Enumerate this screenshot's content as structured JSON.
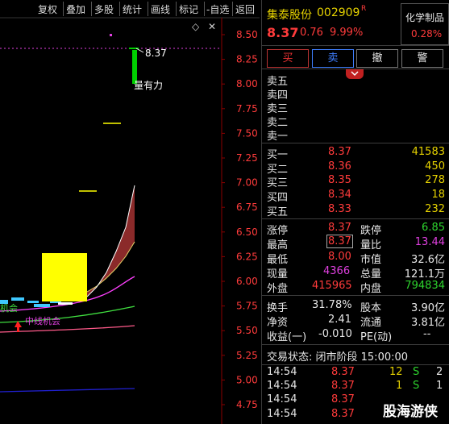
{
  "toolbar": {
    "buttons": [
      "复权",
      "叠加",
      "多股",
      "统计",
      "画线",
      "标记",
      "-自选",
      "返回"
    ],
    "diamond_icon": "◇"
  },
  "chart": {
    "y_ticks": [
      "8.50",
      "8.25",
      "8.00",
      "7.75",
      "7.50",
      "7.25",
      "7.00",
      "6.75",
      "6.50",
      "6.25",
      "6.00",
      "5.75",
      "5.50",
      "5.25",
      "5.00",
      "4.75"
    ],
    "price_annotation": "8.37",
    "volume_annotation": "量有力",
    "signal_text_1": "机会",
    "signal_text_2": "中线机会",
    "colors": {
      "up": "#ff3b3b",
      "down": "#00d000",
      "yellow": "#ffff00",
      "band": "#8b2a2a"
    }
  },
  "stock": {
    "name": "集泰股份",
    "code": "002909",
    "flag": "R",
    "price": "8.37",
    "change": "0.76",
    "change_pct": "9.99%",
    "sector_name": "化学制品",
    "sector_pct": "0.28%"
  },
  "trade_buttons": [
    "买",
    "卖",
    "撤",
    "警"
  ],
  "expand_icon": "chevron-down",
  "sell_levels": [
    {
      "label": "卖五"
    },
    {
      "label": "卖四"
    },
    {
      "label": "卖三"
    },
    {
      "label": "卖二"
    },
    {
      "label": "卖一"
    }
  ],
  "buy_levels": [
    {
      "label": "买一",
      "price": "8.37",
      "vol": "41583"
    },
    {
      "label": "买二",
      "price": "8.36",
      "vol": "450"
    },
    {
      "label": "买三",
      "price": "8.35",
      "vol": "278"
    },
    {
      "label": "买四",
      "price": "8.34",
      "vol": "18"
    },
    {
      "label": "买五",
      "price": "8.33",
      "vol": "232"
    }
  ],
  "stats": {
    "limit_up_label": "涨停",
    "limit_up": "8.37",
    "limit_down_label": "跌停",
    "limit_down": "6.85",
    "high_label": "最高",
    "high": "8.37",
    "vol_ratio_label": "量比",
    "vol_ratio": "13.44",
    "low_label": "最低",
    "low": "8.00",
    "mkt_cap_label": "市值",
    "mkt_cap": "32.6亿",
    "cur_vol_label": "现量",
    "cur_vol": "4366",
    "total_vol_label": "总量",
    "total_vol": "121.1万",
    "outer_label": "外盘",
    "outer": "415965",
    "inner_label": "内盘",
    "inner": "794834",
    "turnover_label": "换手",
    "turnover": "31.78%",
    "capital_label": "股本",
    "capital": "3.90亿",
    "nav_label": "净资",
    "nav": "2.41",
    "float_label": "流通",
    "float": "3.81亿",
    "eps_label": "收益(一)",
    "eps": "-0.010",
    "pe_label": "PE(动)",
    "pe": "--"
  },
  "trade_status": "交易状态: 闭市阶段 15:00:00",
  "ticks": [
    {
      "time": "14:54",
      "price": "8.37",
      "vol": "12",
      "side": "S",
      "count": "2"
    },
    {
      "time": "14:54",
      "price": "8.37",
      "vol": "1",
      "side": "S",
      "count": "1"
    },
    {
      "time": "14:54",
      "price": "8.37",
      "vol": "",
      "side": "",
      "count": ""
    },
    {
      "time": "14:54",
      "price": "8.37",
      "vol": "",
      "side": "",
      "count": ""
    }
  ],
  "watermark": "股海游侠"
}
